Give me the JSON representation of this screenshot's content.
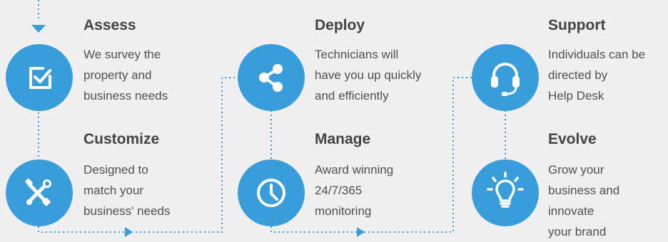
{
  "steps": {
    "assess": {
      "title": "Assess",
      "lines": [
        "We survey the",
        "property and",
        "business needs"
      ],
      "icon": "checkbox-icon"
    },
    "customize": {
      "title": "Customize",
      "lines": [
        "Designed to",
        "match your",
        "business' needs"
      ],
      "icon": "tools-icon"
    },
    "deploy": {
      "title": "Deploy",
      "lines": [
        "Technicians will",
        "have you up quickly",
        "and efficiently"
      ],
      "icon": "share-icon"
    },
    "manage": {
      "title": "Manage",
      "lines": [
        "Award winning",
        "24/7/365",
        "monitoring"
      ],
      "icon": "clock-icon"
    },
    "support": {
      "title": "Support",
      "lines": [
        "Individuals can be",
        "directed by",
        "Help Desk"
      ],
      "icon": "headset-icon"
    },
    "evolve": {
      "title": "Evolve",
      "lines": [
        "Grow your",
        "business and",
        "innovate",
        "your brand"
      ],
      "icon": "lightbulb-icon"
    }
  },
  "colors": {
    "accent": "#3a9ddb",
    "background": "#efefef",
    "title": "#444444",
    "text": "#505050"
  }
}
